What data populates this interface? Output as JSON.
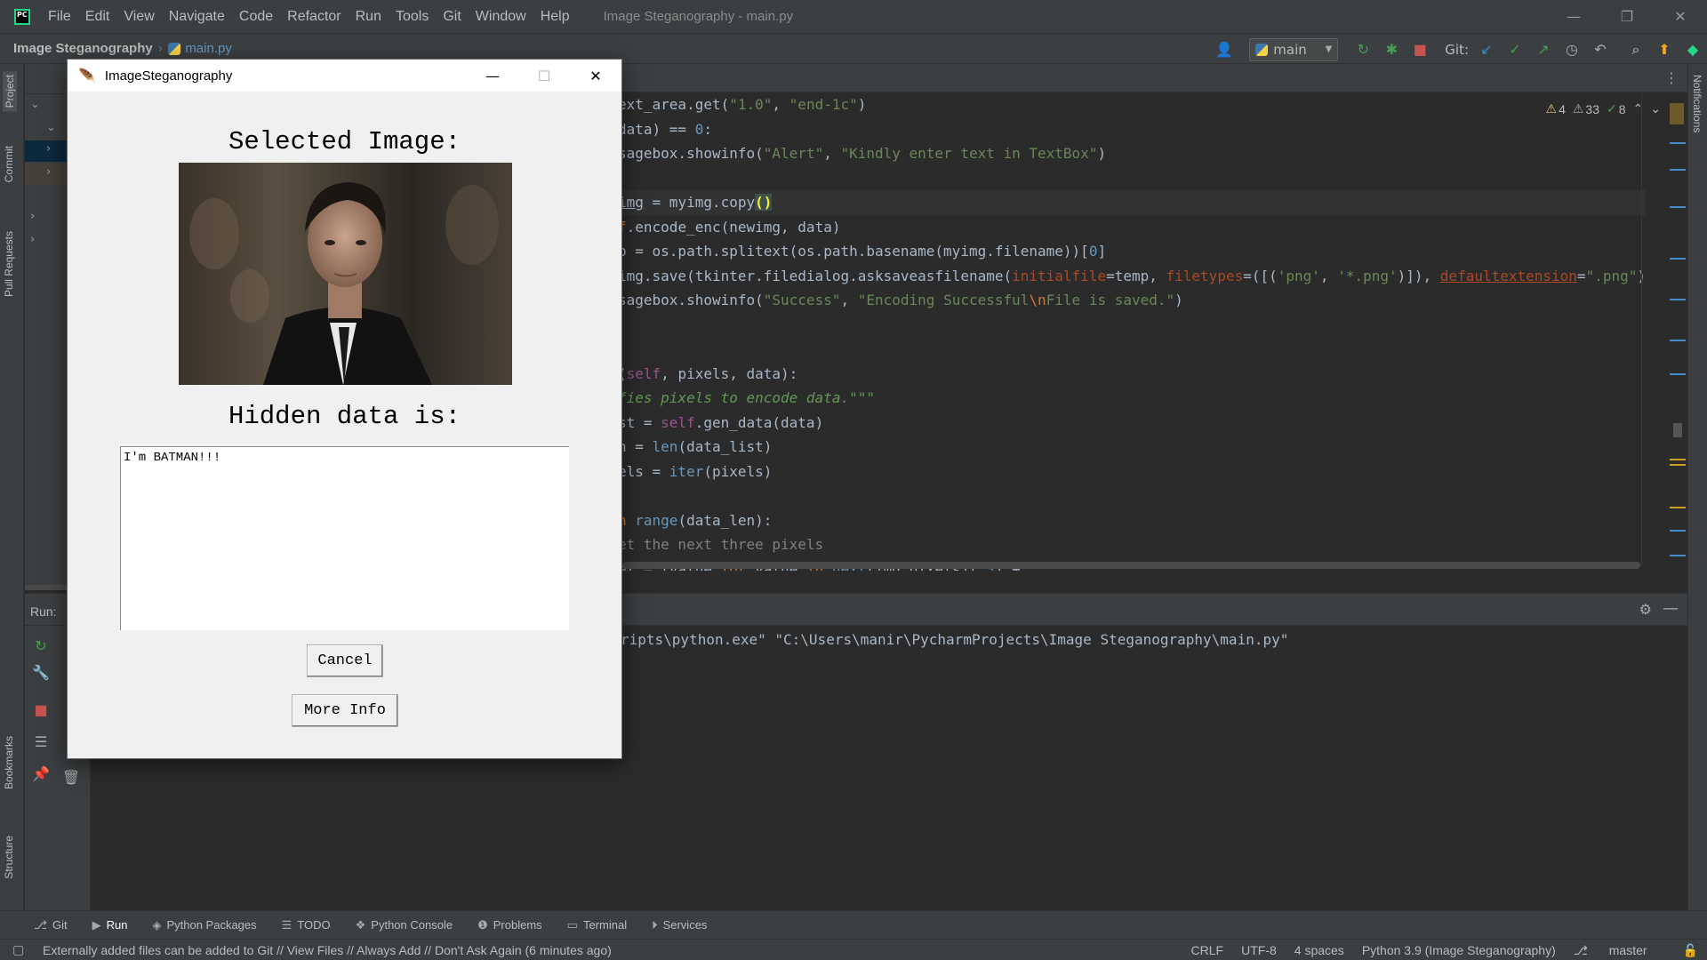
{
  "menu": [
    "File",
    "Edit",
    "View",
    "Navigate",
    "Code",
    "Refactor",
    "Run",
    "Tools",
    "Git",
    "Window",
    "Help"
  ],
  "window_title": "Image Steganography - main.py",
  "nav": {
    "project": "Image Steganography",
    "file": "main.py"
  },
  "toolbar": {
    "run_config": "main",
    "git_label": "Git:"
  },
  "left_tabs": [
    "Project",
    "Commit",
    "Pull Requests",
    "Bookmarks",
    "Structure"
  ],
  "right_tabs": [
    "Notifications"
  ],
  "inspections": {
    "warnings": "4",
    "weak_warnings": "33",
    "typos": "8"
  },
  "code_lines": [
    [
      {
        "t": "ext_area.get("
      },
      {
        "t": "\"1.0\"",
        "c": "s"
      },
      {
        "t": ", "
      },
      {
        "t": "\"end-1c\"",
        "c": "s"
      },
      {
        "t": ")"
      }
    ],
    [
      {
        "t": "data) == "
      },
      {
        "t": "0",
        "c": "n"
      },
      {
        "t": ":"
      }
    ],
    [
      {
        "t": "sagebox.showinfo("
      },
      {
        "t": "\"Alert\"",
        "c": "s"
      },
      {
        "t": ", "
      },
      {
        "t": "\"Kindly enter text in TextBox\"",
        "c": "s"
      },
      {
        "t": ")"
      }
    ],
    [],
    [
      {
        "t": "img",
        "c": "u"
      },
      {
        "t": " = myimg.copy"
      },
      {
        "t": "()",
        "c": "brk"
      }
    ],
    [
      {
        "t": "f",
        "c": "k"
      },
      {
        "t": ".encode_enc(newimg, data)"
      }
    ],
    [
      {
        "t": "p = os.path.splitext(os.path.basename(myimg.filename))["
      },
      {
        "t": "0",
        "c": "n"
      },
      {
        "t": "]"
      }
    ],
    [
      {
        "t": "img.save(tkinter.filedialog.asksaveasfilename("
      },
      {
        "t": "initialfile",
        "c": "prm"
      },
      {
        "t": "=temp, "
      },
      {
        "t": "filetypes",
        "c": "prm"
      },
      {
        "t": "=([("
      },
      {
        "t": "'png'",
        "c": "s"
      },
      {
        "t": ", "
      },
      {
        "t": "'*.png'",
        "c": "s"
      },
      {
        "t": ")]), "
      },
      {
        "t": "defaultextension",
        "c": "prm u"
      },
      {
        "t": "="
      },
      {
        "t": "\".png\"",
        "c": "s"
      },
      {
        "t": ")"
      }
    ],
    [
      {
        "t": "sagebox.showinfo("
      },
      {
        "t": "\"Success\"",
        "c": "s"
      },
      {
        "t": ", "
      },
      {
        "t": "\"Encoding Successful",
        "c": "s"
      },
      {
        "t": "\\n",
        "c": "k"
      },
      {
        "t": "File is saved.\"",
        "c": "s"
      },
      {
        "t": ")"
      }
    ],
    [],
    [],
    [
      {
        "t": "(",
        "c": ""
      },
      {
        "t": "self",
        "c": "p"
      },
      {
        "t": ", pixels, data):"
      }
    ],
    [
      {
        "t": "fies pixels to encode data.\"\"\"",
        "c": "i"
      }
    ],
    [
      {
        "t": "st = "
      },
      {
        "t": "self",
        "c": "p"
      },
      {
        "t": ".gen_data(data)"
      }
    ],
    [
      {
        "t": "n = "
      },
      {
        "t": "len",
        "c": "n"
      },
      {
        "t": "(data_list)"
      }
    ],
    [
      {
        "t": "els = "
      },
      {
        "t": "iter",
        "c": "n"
      },
      {
        "t": "(pixels)"
      }
    ],
    [],
    [
      {
        "t": "n ",
        "c": "k"
      },
      {
        "t": "range",
        "c": "n"
      },
      {
        "t": "(data_len):"
      }
    ],
    [
      {
        "t": "et the next three pixels",
        "c": "c"
      }
    ],
    [
      {
        "t": "el = [value "
      },
      {
        "t": "for",
        "c": "k"
      },
      {
        "t": " value "
      },
      {
        "t": "in",
        "c": "k"
      },
      {
        "t": " "
      },
      {
        "t": "next",
        "c": "n"
      },
      {
        "t": "(img_pixels)[:"
      },
      {
        "t": "3",
        "c": "n"
      },
      {
        "t": "] +"
      }
    ]
  ],
  "run_panel": {
    "title": "Run:",
    "console": "ripts\\python.exe\" \"C:\\Users\\manir\\PycharmProjects\\Image Steganography\\main.py\""
  },
  "bottom_tabs": [
    "Git",
    "Run",
    "Python Packages",
    "TODO",
    "Python Console",
    "Problems",
    "Terminal",
    "Services"
  ],
  "status": {
    "message": "Externally added files can be added to Git // View Files // Always Add // Don't Ask Again (6 minutes ago)",
    "line_sep": "CRLF",
    "encoding": "UTF-8",
    "indent": "4 spaces",
    "interpreter": "Python 3.9 (Image Steganography)",
    "branch": "master"
  },
  "dialog": {
    "title": "ImageSteganography",
    "heading_selected": "Selected Image:",
    "heading_hidden": "Hidden data is:",
    "hidden_text": "I'm BATMAN!!!",
    "cancel_label": "Cancel",
    "more_info_label": "More Info"
  },
  "colors": {
    "ide_bg": "#2b2b2b",
    "ide_panel": "#3c3f41",
    "dialog_bg": "#f0f0f0",
    "string": "#6a8759",
    "keyword": "#cc7832"
  }
}
